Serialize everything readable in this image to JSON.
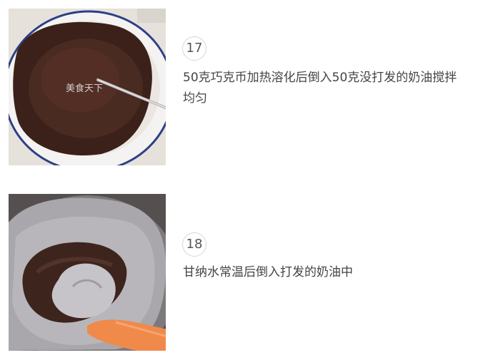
{
  "steps": [
    {
      "number": "17",
      "text": "50克巧克币加热溶化后倒入50克没打发的奶油搅拌均匀",
      "watermark": "美食天下"
    },
    {
      "number": "18",
      "text": "甘纳水常温后倒入打发的奶油中"
    }
  ]
}
